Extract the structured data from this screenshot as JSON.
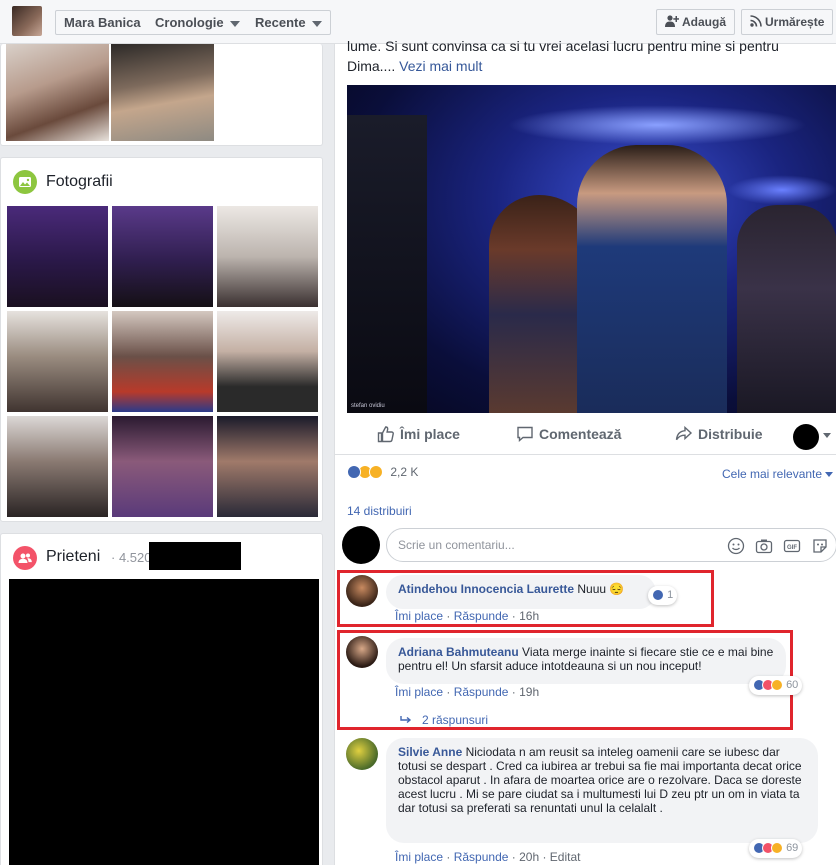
{
  "topbar": {
    "name": "Mara Banica",
    "timeline": "Cronologie",
    "recent": "Recente",
    "add_friend": "Adaugă",
    "follow": "Urmărește"
  },
  "photos": {
    "title": "Fotografii"
  },
  "friends": {
    "title": "Prieteni",
    "count": "· 4.520"
  },
  "post": {
    "text_line1": "lume. Si sunt convinsa ca si tu vrei acelasi lucru pentru mine si pentru",
    "text_line2": "Dima....",
    "see_more": "Vezi mai mult",
    "photo_credit": "stefan ovidiu",
    "actions": {
      "like": "Îmi place",
      "comment": "Comentează",
      "share": "Distribuie"
    },
    "reactions_count": "2,2 K",
    "sort": "Cele mai relevante",
    "shares": "14 distribuiri",
    "comment_placeholder": "Scrie un comentariu..."
  },
  "comments": [
    {
      "author": "Atindehou Innocencia Laurette",
      "text": "Nuuu",
      "emoji": "😔",
      "like": "Îmi place",
      "reply": "Răspunde",
      "time": "16h",
      "reaction_count": "1"
    },
    {
      "author": "Adriana Bahmuteanu",
      "text": "Viata merge inainte si fiecare stie ce e mai bine pentru el! Un sfarsit aduce intotdeauna si un nou inceput!",
      "like": "Îmi place",
      "reply": "Răspunde",
      "time": "19h",
      "reaction_count": "60",
      "replies": "2 răspunsuri"
    },
    {
      "author": "Silvie Anne",
      "text": "Niciodata n am reusit sa inteleg oamenii care se iubesc dar totusi se despart . Cred ca iubirea ar trebui sa fie mai importanta decat orice obstacol aparut . In afara de moartea orice are o rezolvare. Daca se doreste acest lucru . Mi se pare ciudat sa i multumesti lui D zeu ptr un om in viata ta dar totusi sa preferati sa renuntati unul la celalalt .",
      "like": "Îmi place",
      "reply": "Răspunde",
      "time": "20h",
      "edited": "Editat",
      "reaction_count": "69"
    }
  ],
  "colors": {
    "accent": "#4267b2",
    "highlight": "#e0252d",
    "link": "#385898"
  }
}
